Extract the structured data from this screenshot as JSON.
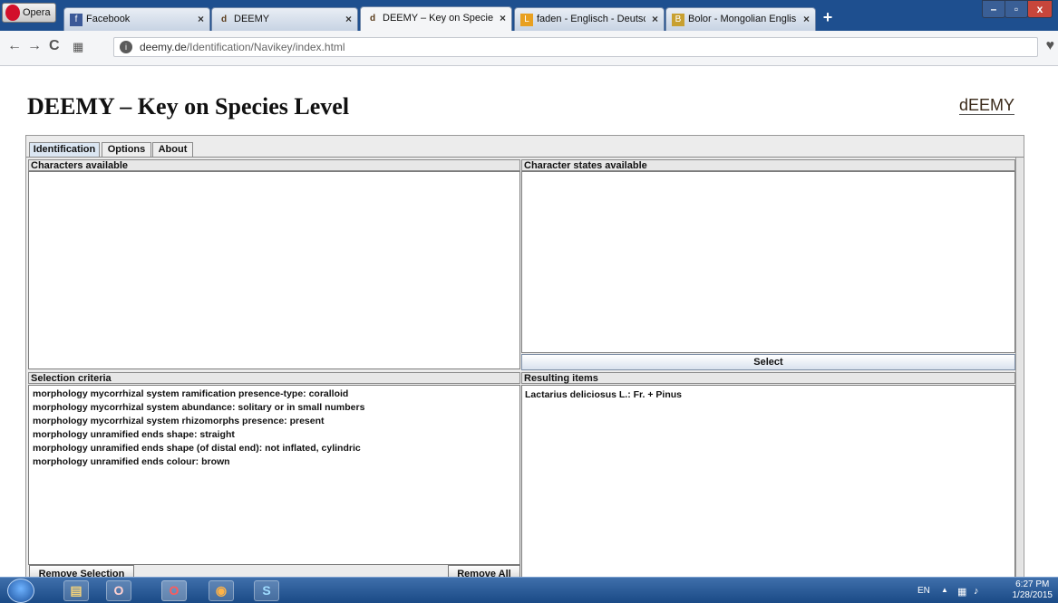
{
  "browser": {
    "menu_label": "Opera",
    "tabs": [
      {
        "label": "Facebook",
        "favicon": "f"
      },
      {
        "label": "DEEMY",
        "favicon": "d"
      },
      {
        "label": "DEEMY – Key on Species L",
        "favicon": "d"
      },
      {
        "label": "faden - Englisch - Deutsch",
        "favicon": "L"
      },
      {
        "label": "Bolor - Mongolian English",
        "favicon": "B"
      }
    ],
    "new_tab": "+",
    "url_domain": "deemy.de",
    "url_path": "/Identification/Navikey/index.html"
  },
  "page": {
    "title": "DEEMY – Key on Species Level",
    "brand": "dEEMY"
  },
  "app": {
    "tabs": [
      "Identification",
      "Options",
      "About"
    ],
    "characters_label": "Characters available",
    "states_label": "Character states available",
    "select_label": "Select",
    "criteria_label": "Selection criteria",
    "results_label": "Resulting items",
    "criteria": [
      "morphology mycorrhizal system ramification presence-type:  coralloid",
      "morphology mycorrhizal system abundance:  solitary or in small numbers",
      "morphology mycorrhizal system rhizomorphs presence:  present",
      "morphology unramified ends shape:  straight",
      "morphology unramified ends shape (of distal end):  not inflated, cylindric",
      "morphology unramified ends colour:  brown"
    ],
    "results": [
      "Lactarius deliciosus L.: Fr. + Pinus"
    ],
    "remove_selection_label": "Remove Selection",
    "remove_all_label": "Remove All"
  },
  "taskbar": {
    "lang": "EN",
    "time": "6:27 PM",
    "date": "1/28/2015"
  }
}
